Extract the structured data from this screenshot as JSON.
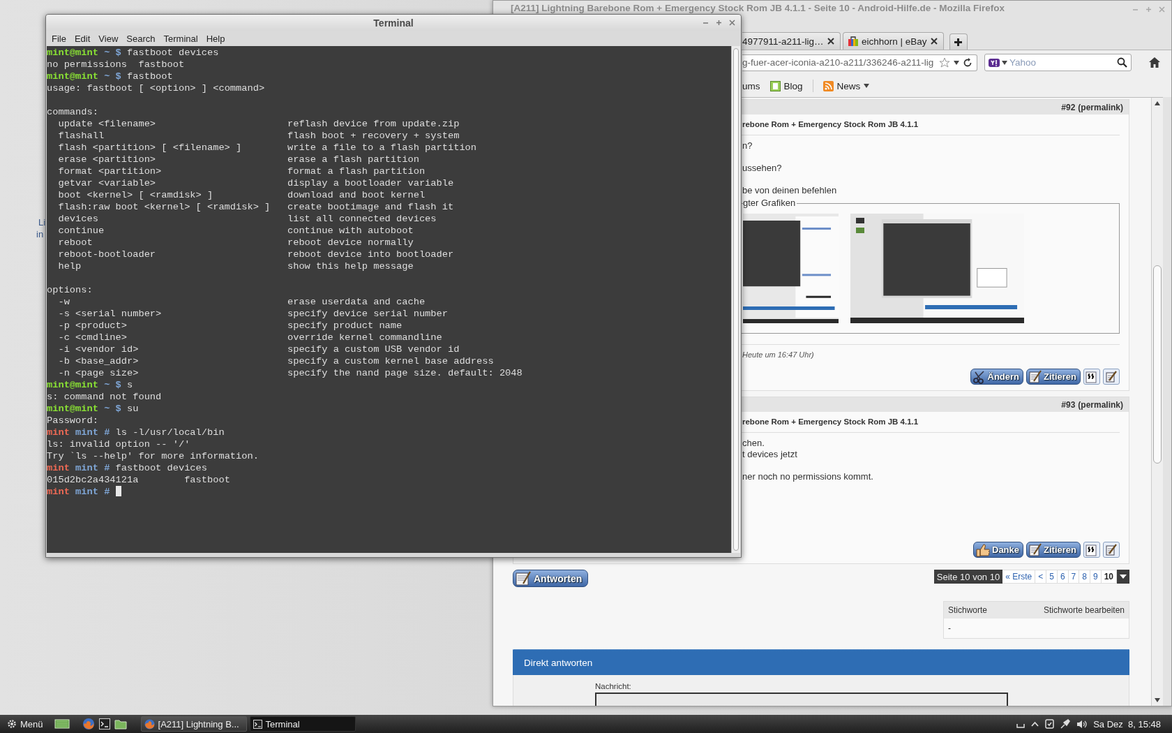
{
  "desktop": {
    "icon_label_fragments": [
      "Li",
      "in"
    ]
  },
  "terminal": {
    "title": "Terminal",
    "menu": [
      "File",
      "Edit",
      "View",
      "Search",
      "Terminal",
      "Help"
    ],
    "lines": [
      {
        "kind": "user",
        "user": "mint@mint",
        "path": "~ $",
        "command": "fastboot devices"
      },
      {
        "kind": "output",
        "text": "no permissions  fastboot"
      },
      {
        "kind": "user",
        "user": "mint@mint",
        "path": "~ $",
        "command": "fastboot"
      },
      {
        "kind": "output",
        "text": "usage: fastboot [ <option> ] <command>"
      },
      {
        "kind": "blank"
      },
      {
        "kind": "output",
        "text": "commands:"
      },
      {
        "kind": "entry",
        "name": "update <filename>",
        "description": "reflash device from update.zip"
      },
      {
        "kind": "entry",
        "name": "flashall",
        "description": "flash boot + recovery + system"
      },
      {
        "kind": "entry",
        "name": "flash <partition> [ <filename> ]",
        "description": "write a file to a flash partition"
      },
      {
        "kind": "entry",
        "name": "erase <partition>",
        "description": "erase a flash partition"
      },
      {
        "kind": "entry",
        "name": "format <partition>",
        "description": "format a flash partition"
      },
      {
        "kind": "entry",
        "name": "getvar <variable>",
        "description": "display a bootloader variable"
      },
      {
        "kind": "entry",
        "name": "boot <kernel> [ <ramdisk> ]",
        "description": "download and boot kernel"
      },
      {
        "kind": "entry",
        "name": "flash:raw boot <kernel> [ <ramdisk> ]",
        "description": "create bootimage and flash it"
      },
      {
        "kind": "entry",
        "name": "devices",
        "description": "list all connected devices"
      },
      {
        "kind": "entry",
        "name": "continue",
        "description": "continue with autoboot"
      },
      {
        "kind": "entry",
        "name": "reboot",
        "description": "reboot device normally"
      },
      {
        "kind": "entry",
        "name": "reboot-bootloader",
        "description": "reboot device into bootloader"
      },
      {
        "kind": "entry",
        "name": "help",
        "description": "show this help message"
      },
      {
        "kind": "blank"
      },
      {
        "kind": "output",
        "text": "options:"
      },
      {
        "kind": "entry",
        "name": "-w",
        "description": "erase userdata and cache"
      },
      {
        "kind": "entry",
        "name": "-s <serial number>",
        "description": "specify device serial number"
      },
      {
        "kind": "entry",
        "name": "-p <product>",
        "description": "specify product name"
      },
      {
        "kind": "entry",
        "name": "-c <cmdline>",
        "description": "override kernel commandline"
      },
      {
        "kind": "entry",
        "name": "-i <vendor id>",
        "description": "specify a custom USB vendor id"
      },
      {
        "kind": "entry",
        "name": "-b <base_addr>",
        "description": "specify a custom kernel base address"
      },
      {
        "kind": "entry",
        "name": "-n <page size>",
        "description": "specify the nand page size. default: 2048"
      },
      {
        "kind": "user",
        "user": "mint@mint",
        "path": "~ $",
        "command": "s"
      },
      {
        "kind": "output",
        "text": "s: command not found"
      },
      {
        "kind": "user",
        "user": "mint@mint",
        "path": "~ $",
        "command": "su"
      },
      {
        "kind": "output",
        "text": "Password:"
      },
      {
        "kind": "root",
        "user": "mint",
        "path": "mint #",
        "command": "ls -l/usr/local/bin"
      },
      {
        "kind": "output",
        "text": "ls: invalid option -- '/'"
      },
      {
        "kind": "output",
        "text": "Try `ls --help' for more information."
      },
      {
        "kind": "root",
        "user": "mint",
        "path": "mint #",
        "command": "fastboot devices"
      },
      {
        "kind": "output",
        "text": "015d2bc2a434121a        fastboot"
      },
      {
        "kind": "root",
        "user": "mint",
        "path": "mint #",
        "cursor": true
      }
    ]
  },
  "browser": {
    "title": "[A211] Lightning Barebone Rom + Emergency Stock Rom JB 4.1.1 - Seite 10 - Android-Hilfe.de - Mozilla Firefox",
    "tabs": [
      {
        "label": "4977911-a211-lig…",
        "selected": false
      },
      {
        "label": "eichhorn | eBay",
        "selected": false
      }
    ],
    "address": "g-fuer-acer-iconia-a210-a211/336246-a211-lig",
    "search_placeholder": "Yahoo",
    "bookmarks": [
      {
        "label": "ums",
        "kind": "plain"
      },
      {
        "label": "Blog",
        "kind": "blog"
      },
      {
        "label": "News",
        "kind": "feed"
      }
    ],
    "page": {
      "posts": [
        {
          "number": "#92",
          "permalink": "(permalink)",
          "title": "rebone Rom + Emergency Stock Rom JB 4.1.1",
          "paragraphs": [
            [
              "n?"
            ],
            [
              "ussehen?"
            ],
            [
              "be von deinen befehlen"
            ]
          ],
          "attachments": {
            "legend": "gter Grafiken"
          },
          "edited": "Heute um 16:47 Uhr)",
          "buttons": [
            {
              "label": "Ändern",
              "kind": "edit"
            },
            {
              "label": "Zitieren",
              "kind": "quote"
            }
          ]
        },
        {
          "number": "#93",
          "permalink": "(permalink)",
          "title": "rebone Rom + Emergency Stock Rom JB 4.1.1",
          "paragraphs": [
            [
              "chen.",
              "t devices jetzt"
            ],
            [
              "ner noch no permissions kommt."
            ]
          ],
          "buttons": [
            {
              "label": "Danke",
              "kind": "thanks"
            },
            {
              "label": "Zitieren",
              "kind": "quote"
            }
          ]
        }
      ],
      "reply_button": "Antworten",
      "pagination": {
        "label": "Seite 10 von 10",
        "first": "« Erste",
        "previous": "<",
        "pages": [
          {
            "label": "5",
            "selected": false
          },
          {
            "label": "6",
            "selected": false
          },
          {
            "label": "7",
            "selected": false
          },
          {
            "label": "8",
            "selected": false
          },
          {
            "label": "9",
            "selected": false
          },
          {
            "label": "10",
            "selected": true
          }
        ]
      },
      "tags": {
        "title": "Stichworte",
        "edit": "Stichworte bearbeiten",
        "value": "-"
      },
      "quick_reply": {
        "title": "Direkt antworten",
        "message_label": "Nachricht:"
      }
    }
  },
  "taskbar": {
    "menu": "Menü",
    "tasks": [
      {
        "label": "[A211] Lightning B...",
        "selected": false
      },
      {
        "label": "Terminal",
        "selected": true
      }
    ],
    "clock": "Sa Dez  8, 15:48"
  }
}
